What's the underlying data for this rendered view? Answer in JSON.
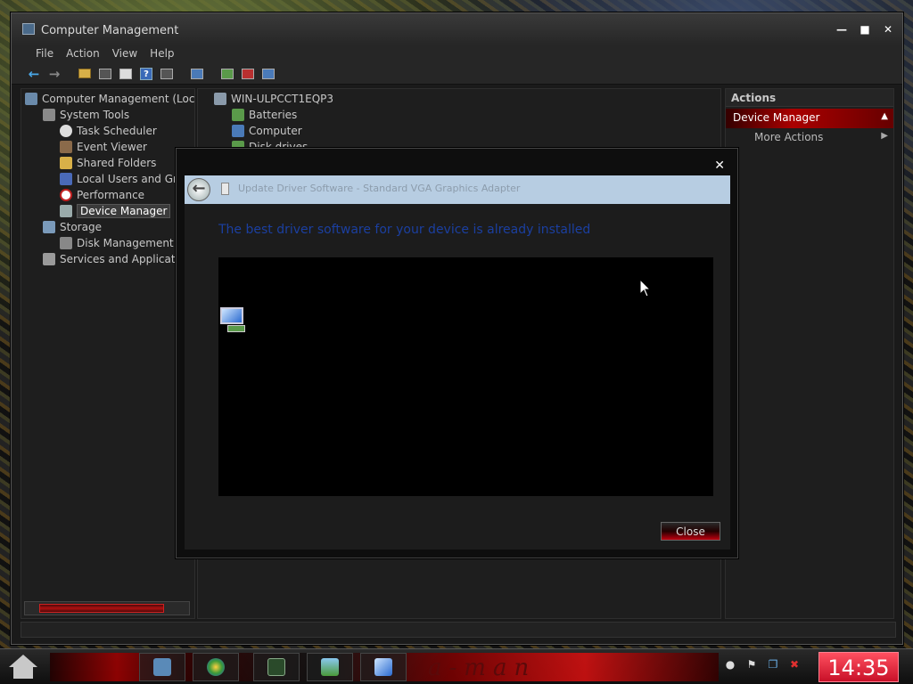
{
  "window": {
    "title": "Computer Management",
    "minimize_glyph": "—",
    "maximize_glyph": "■",
    "close_glyph": "✕"
  },
  "menu": [
    "File",
    "Action",
    "View",
    "Help"
  ],
  "toolbar_icons": [
    "back-arrow-icon",
    "forward-arrow-icon",
    "folder-up-icon",
    "show-hide-tree-icon",
    "properties-icon",
    "help-icon",
    "show-hide-action-pane-icon",
    "scan-hardware-icon",
    "update-driver-icon",
    "uninstall-icon",
    "enable-device-icon"
  ],
  "left_tree": [
    {
      "label": "Computer Management (Loca",
      "icon": "computer-management-icon",
      "level": 0
    },
    {
      "label": "System Tools",
      "icon": "tools-icon",
      "level": 1
    },
    {
      "label": "Task Scheduler",
      "icon": "clock-icon",
      "level": 2
    },
    {
      "label": "Event Viewer",
      "icon": "event-viewer-icon",
      "level": 2
    },
    {
      "label": "Shared Folders",
      "icon": "shared-folder-icon",
      "level": 2
    },
    {
      "label": "Local Users and Gro",
      "icon": "users-icon",
      "level": 2
    },
    {
      "label": "Performance",
      "icon": "performance-icon",
      "level": 2
    },
    {
      "label": "Device Manager",
      "icon": "device-manager-icon",
      "level": 2,
      "selected": true
    },
    {
      "label": "Storage",
      "icon": "storage-icon",
      "level": 1
    },
    {
      "label": "Disk Management",
      "icon": "disk-icon",
      "level": 2
    },
    {
      "label": "Services and Applicatio",
      "icon": "services-icon",
      "level": 1
    }
  ],
  "device_tree": [
    {
      "label": "WIN-ULPCCT1EQP3",
      "icon": "computer-icon"
    },
    {
      "label": "Batteries",
      "icon": "battery-icon"
    },
    {
      "label": "Computer",
      "icon": "computer-icon"
    },
    {
      "label": "Disk drives",
      "icon": "disk-drive-icon"
    }
  ],
  "actions": {
    "header": "Actions",
    "section": "Device Manager",
    "section_caret": "▲",
    "more": "More Actions",
    "more_caret": "▶"
  },
  "dialog": {
    "close_glyph": "✕",
    "back_glyph": "←",
    "title": "Update Driver Software - Standard VGA Graphics Adapter",
    "message": "The best driver software for your device is already installed",
    "close_button": "Close"
  },
  "taskbar": {
    "deco_text": "a-man",
    "apps": [
      "file-explorer-icon",
      "windows-orb-icon",
      "calculator-icon",
      "image-viewer-icon",
      "device-manager-icon"
    ],
    "tray": [
      "dot-icon",
      "action-center-flag-icon",
      "network-icon",
      "volume-muted-icon"
    ],
    "tray_glyphs": [
      "●",
      "⚑",
      "❐",
      "✖"
    ],
    "clock": "14:35"
  },
  "colors": {
    "accent_red": "#c00010",
    "dialog_header": "#b7cde2",
    "message_blue": "#1b3fa0"
  }
}
